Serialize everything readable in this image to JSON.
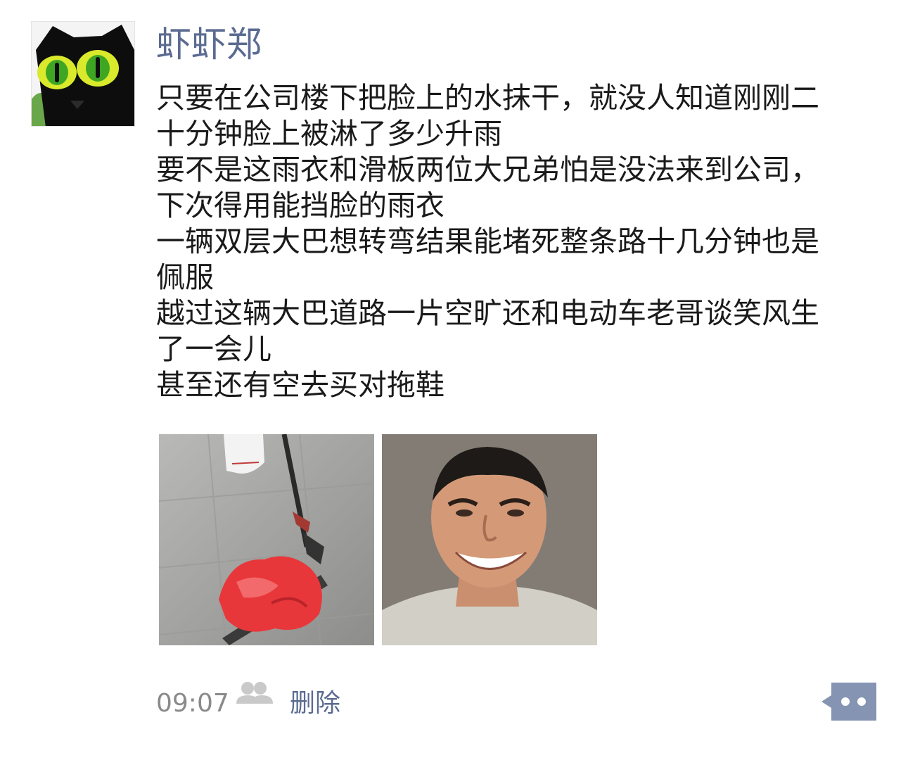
{
  "post": {
    "username": "虾虾郑",
    "avatar_icon": "black-cat-avatar-icon",
    "text_lines": [
      "只要在公司楼下把脸上的水抹干，就没人知道刚刚二",
      "十分钟脸上被淋了多少升雨",
      "要不是这雨衣和滑板两位大兄弟怕是没法来到公司，",
      "下次得用能挡脸的雨衣",
      "一辆双层大巴想转弯结果能堵死整条路十几分钟也是",
      "佩服",
      "越过这辆大巴道路一片空旷还和电动车老哥谈笑风生",
      "了一会儿",
      "甚至还有空去买对拖鞋"
    ],
    "photos": [
      {
        "name": "scooter-raincoat-photo"
      },
      {
        "name": "smiling-man-photo"
      }
    ],
    "footer": {
      "time": "09:07",
      "visibility_icon": "friends-icon",
      "delete_label": "删除",
      "comment_icon": "comment-dots-icon"
    }
  },
  "colors": {
    "name_link": "#5b6b91",
    "text": "#1a1a1a",
    "time": "#8a8a8a",
    "friends_icon": "#c9c9c9"
  }
}
